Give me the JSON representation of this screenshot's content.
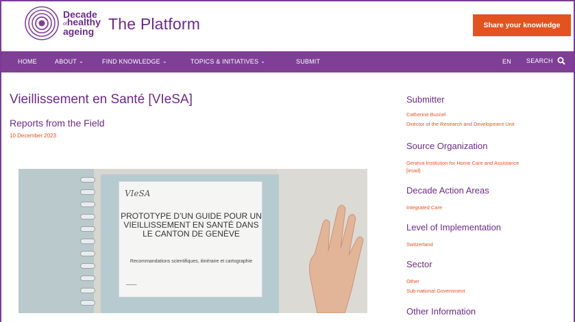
{
  "header": {
    "logo_line1": "Decade",
    "logo_line2": "of",
    "logo_line3": "healthy",
    "logo_line4": "ageing",
    "title": "The Platform",
    "share_button": "Share your knowledge"
  },
  "nav": {
    "items": [
      {
        "label": "HOME"
      },
      {
        "label": "ABOUT"
      },
      {
        "label": "FIND KNOWLEDGE"
      },
      {
        "label": "TOPICS & INITIATIVES"
      },
      {
        "label": "SUBMIT"
      }
    ],
    "language": "EN",
    "search": "SEARCH"
  },
  "main": {
    "title": "Vieillissement en Santé [VIeSA]",
    "subtitle": "Reports from the Field",
    "date": "10 December 2023",
    "image": {
      "brand": "VIeSA",
      "heading": "PROTOTYPE D’UN GUIDE POUR UN VIEILLISSEMENT EN SANTÉ DANS LE CANTON DE GENÈVE",
      "subheading": "Recommandations scientifiques, itinéraire et cartographie"
    }
  },
  "sidebar": {
    "submitter_heading": "Submitter",
    "submitter_name": "Catherine Busnel",
    "submitter_role": "Director of the Research and Development Unit",
    "source_heading": "Source Organization",
    "source_line1": "Geneva Institution for Home Care and Assistance",
    "source_line2": "[imad]",
    "action_heading": "Decade Action Areas",
    "action_value": "Integrated Care",
    "level_heading": "Level of Implementation",
    "level_value": "Switzerland",
    "sector_heading": "Sector",
    "sector_value1": "Other",
    "sector_value2": "Sub-national Government",
    "other_heading": "Other Information"
  },
  "colors": {
    "brand_purple": "#7f3f96",
    "accent_orange": "#e3531f",
    "text_purple": "#6b2a85"
  }
}
